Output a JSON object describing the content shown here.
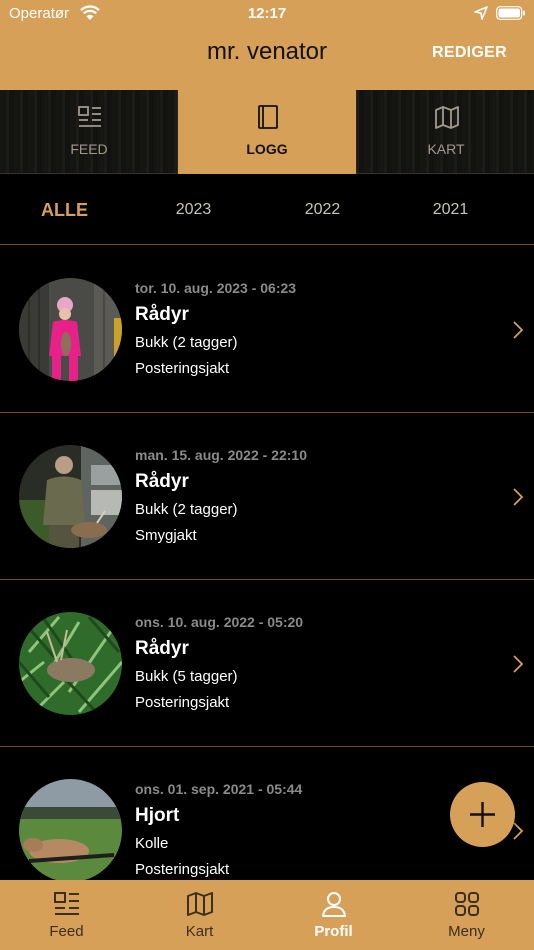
{
  "status_bar": {
    "carrier": "Operatør",
    "time": "12:17"
  },
  "header": {
    "title": "mr. venator",
    "edit_label": "REDIGER"
  },
  "segments": [
    {
      "label": "FEED",
      "icon": "feed-icon",
      "active": false
    },
    {
      "label": "LOGG",
      "icon": "book-icon",
      "active": true
    },
    {
      "label": "KART",
      "icon": "map-icon",
      "active": false
    }
  ],
  "year_filter": [
    {
      "label": "ALLE",
      "active": true
    },
    {
      "label": "2023",
      "active": false
    },
    {
      "label": "2022",
      "active": false
    },
    {
      "label": "2021",
      "active": false
    }
  ],
  "entries": [
    {
      "date": "tor. 10. aug. 2023 - 06:23",
      "species": "Rådyr",
      "detail": "Bukk (2 tagger)",
      "method": "Posteringsjakt"
    },
    {
      "date": "man. 15. aug. 2022 - 22:10",
      "species": "Rådyr",
      "detail": "Bukk (2 tagger)",
      "method": "Smygjakt"
    },
    {
      "date": "ons. 10. aug. 2022 - 05:20",
      "species": "Rådyr",
      "detail": "Bukk (5 tagger)",
      "method": "Posteringsjakt"
    },
    {
      "date": "ons. 01. sep. 2021 - 05:44",
      "species": "Hjort",
      "detail": "Kolle",
      "method": "Posteringsjakt"
    }
  ],
  "tabbar": [
    {
      "label": "Feed",
      "icon": "feed-icon",
      "active": false
    },
    {
      "label": "Kart",
      "icon": "map-icon",
      "active": false
    },
    {
      "label": "Profil",
      "icon": "person-icon",
      "active": true
    },
    {
      "label": "Meny",
      "icon": "grid-icon",
      "active": false
    }
  ],
  "colors": {
    "accent": "#d6a058",
    "background": "#000000",
    "divider": "#6b4f2a",
    "muted_text": "#8a8a8a"
  }
}
